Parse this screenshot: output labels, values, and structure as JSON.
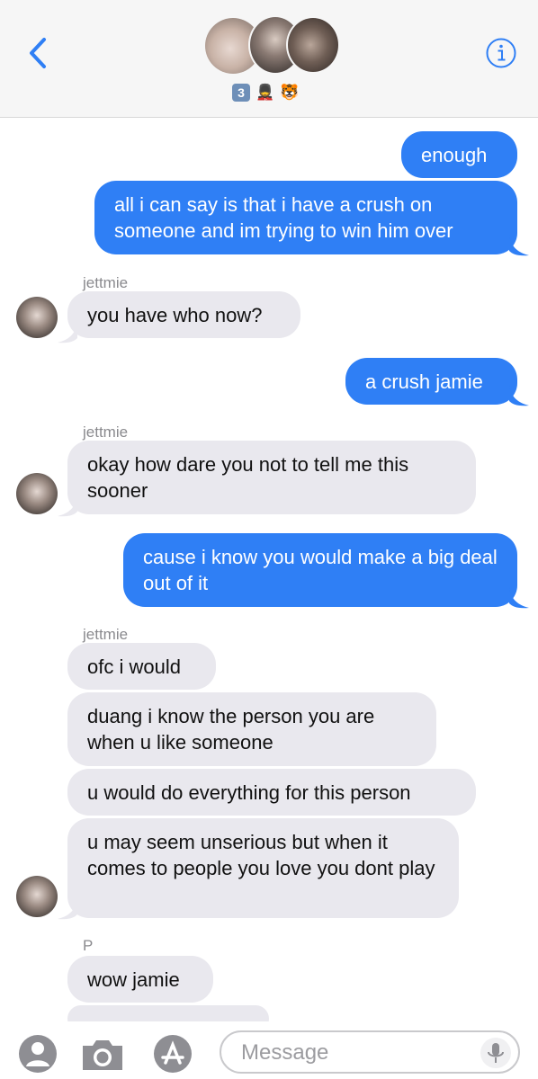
{
  "header": {
    "group_badges": [
      "3",
      "💂",
      "🐯"
    ]
  },
  "messages": [
    {
      "dir": "out",
      "text": "enough"
    },
    {
      "dir": "out",
      "text": "all i can say is that i have a crush on someone and im trying to win him over"
    },
    {
      "dir": "in",
      "sender": "jettmie",
      "text": "you have who now?"
    },
    {
      "dir": "out",
      "text": "a crush jamie"
    },
    {
      "dir": "in",
      "sender": "jettmie",
      "text": "okay how dare you not to tell me this sooner"
    },
    {
      "dir": "out",
      "text": "cause i know you would make a big deal out of it"
    },
    {
      "dir": "in",
      "sender": "jettmie",
      "text": "ofc i would"
    },
    {
      "dir": "in",
      "text": "duang i know the person you are when u like someone"
    },
    {
      "dir": "in",
      "text": "u would do everything for this person"
    },
    {
      "dir": "in",
      "text": "u may seem unserious but when it comes to people you love you dont play"
    },
    {
      "dir": "in",
      "sender": "P",
      "text": "wow jamie"
    }
  ],
  "compose": {
    "placeholder": "Message"
  },
  "colors": {
    "accent": "#2f7ff5",
    "incoming_bubble": "#e9e8ee"
  }
}
